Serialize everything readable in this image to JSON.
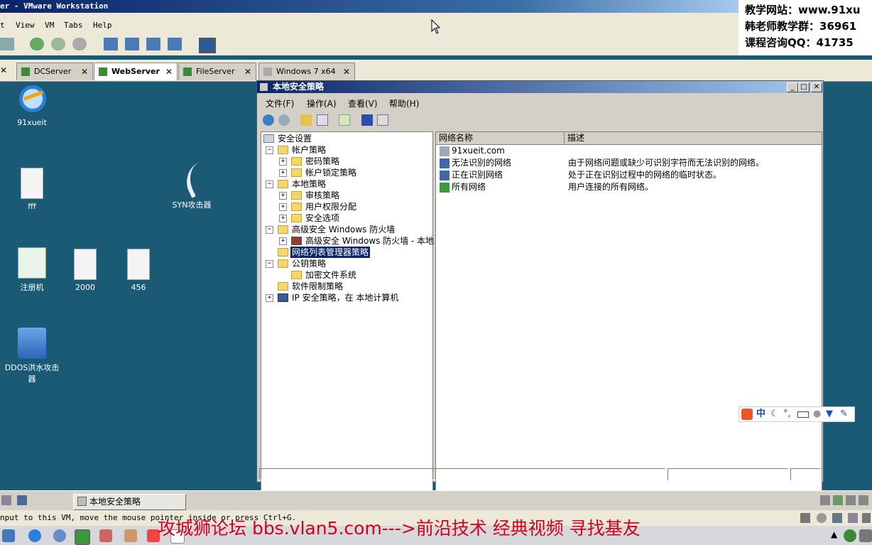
{
  "vmware": {
    "title": "er - VMware Workstation",
    "menu": [
      "t",
      "View",
      "VM",
      "Tabs",
      "Help"
    ],
    "tabs": [
      {
        "label": "DCServer",
        "active": false
      },
      {
        "label": "WebServer",
        "active": true
      },
      {
        "label": "FileServer",
        "active": false
      },
      {
        "label": "Windows 7 x64",
        "active": false
      }
    ],
    "status_text": "nput to this VM, move the mouse pointer inside or press Ctrl+G."
  },
  "banner": {
    "line1": "教学网站：www.91xu",
    "line2": "韩老师教学群：36961",
    "line3": "课程咨询QQ：41735"
  },
  "desktop": {
    "icons": [
      {
        "label": "91xueit"
      },
      {
        "label": "fff"
      },
      {
        "label": "SYN攻击器"
      },
      {
        "label": "注册机"
      },
      {
        "label": "2000"
      },
      {
        "label": "456"
      },
      {
        "label": "DDOS洪水攻击器"
      }
    ]
  },
  "mmc": {
    "title": "本地安全策略",
    "menu": [
      "文件(F)",
      "操作(A)",
      "查看(V)",
      "帮助(H)"
    ],
    "tree": [
      {
        "label": "安全设置",
        "level": 0,
        "exp": ""
      },
      {
        "label": "帐户策略",
        "level": 1,
        "exp": "−"
      },
      {
        "label": "密码策略",
        "level": 2,
        "exp": "+"
      },
      {
        "label": "帐户锁定策略",
        "level": 2,
        "exp": "+"
      },
      {
        "label": "本地策略",
        "level": 1,
        "exp": "−"
      },
      {
        "label": "审核策略",
        "level": 2,
        "exp": "+"
      },
      {
        "label": "用户权限分配",
        "level": 2,
        "exp": "+"
      },
      {
        "label": "安全选项",
        "level": 2,
        "exp": "+"
      },
      {
        "label": "高级安全 Windows 防火墙",
        "level": 1,
        "exp": "−"
      },
      {
        "label": "高级安全 Windows 防火墙 - 本地",
        "level": 2,
        "exp": "+"
      },
      {
        "label": "网络列表管理器策略",
        "level": 1,
        "exp": "",
        "selected": true
      },
      {
        "label": "公钥策略",
        "level": 1,
        "exp": "−"
      },
      {
        "label": "加密文件系统",
        "level": 2,
        "exp": ""
      },
      {
        "label": "软件限制策略",
        "level": 1,
        "exp": ""
      },
      {
        "label": "IP 安全策略，在 本地计算机",
        "level": 1,
        "exp": "+"
      }
    ],
    "columns": [
      "网络名称",
      "描述"
    ],
    "rows": [
      {
        "name": "91xueit.com",
        "desc": ""
      },
      {
        "name": "无法识别的网络",
        "desc": "由于网络问题或缺少可识别字符而无法识别的网络。"
      },
      {
        "name": "正在识别网络",
        "desc": "处于正在识别过程中的网络的临时状态。"
      },
      {
        "name": "所有网络",
        "desc": "用户连接的所有网络。"
      }
    ]
  },
  "guest_taskbar": {
    "task_label": "本地安全策略"
  },
  "ime": {
    "text": "中"
  },
  "watermark": "攻城狮论坛 bbs.vlan5.com--->前沿技术 经典视频 寻找基友",
  "colors": {
    "desktop": "#1b5a75",
    "titlebar": "#0a246a",
    "watermark": "#d4001c"
  }
}
